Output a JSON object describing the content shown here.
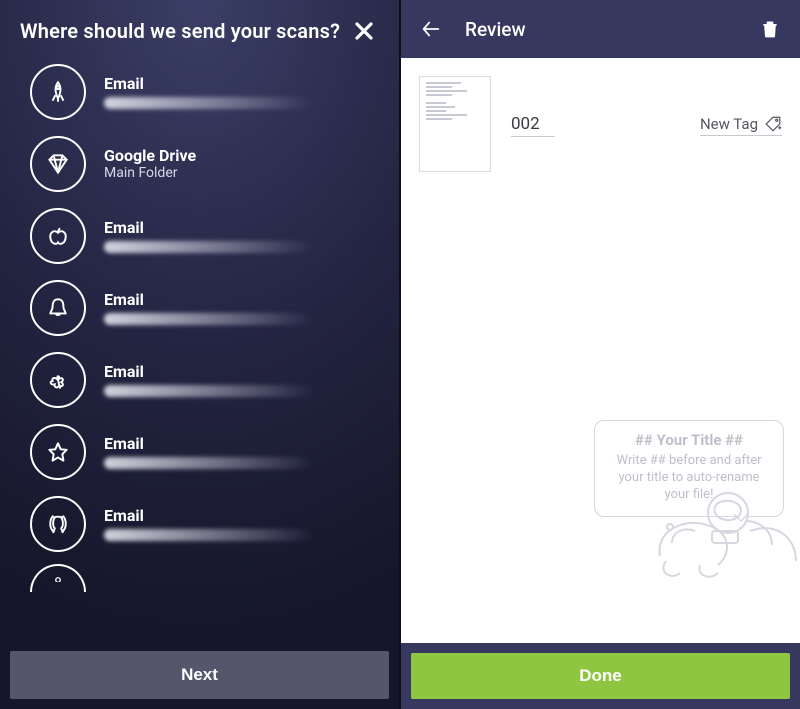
{
  "left": {
    "title": "Where should we send your scans?",
    "next_label": "Next",
    "destinations": [
      {
        "icon": "rocket",
        "title": "Email",
        "sub": "",
        "redacted": true
      },
      {
        "icon": "diamond",
        "title": "Google Drive",
        "sub": "Main Folder",
        "redacted": false
      },
      {
        "icon": "apple",
        "title": "Email",
        "sub": "",
        "redacted": true
      },
      {
        "icon": "bell",
        "title": "Email",
        "sub": "",
        "redacted": true
      },
      {
        "icon": "clover",
        "title": "Email",
        "sub": "",
        "redacted": true
      },
      {
        "icon": "star",
        "title": "Email",
        "sub": "",
        "redacted": true
      },
      {
        "icon": "horseshoe",
        "title": "Email",
        "sub": "",
        "redacted": true
      }
    ]
  },
  "right": {
    "title": "Review",
    "doc_name": "002",
    "new_tag_label": "New Tag",
    "hint_title": "## Your Title ##",
    "hint_body": "Write ## before and after your title to auto-rename your file!",
    "done_label": "Done"
  },
  "colors": {
    "left_bg_top": "#3b3e66",
    "left_bg_bottom": "#151629",
    "header_bar": "#363860",
    "done_green": "#8fc641",
    "next_grey": "#55566c"
  }
}
